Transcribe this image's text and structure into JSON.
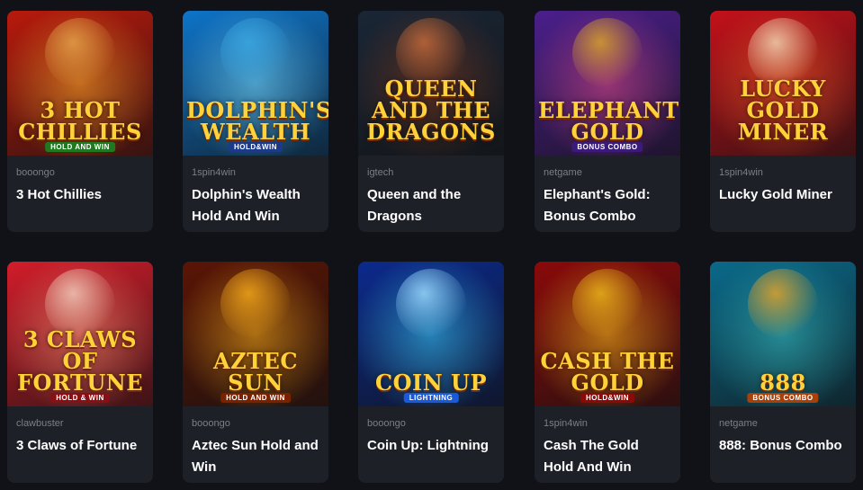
{
  "games": [
    {
      "provider": "booongo",
      "title": "3 Hot Chillies",
      "logo": "3 HOT CHILLIES",
      "sub": "HOLD AND WIN",
      "bg": "#b81a0c",
      "glow": "#ffb12b",
      "fig": "#e2a14a",
      "subbg": "#1f7a1f"
    },
    {
      "provider": "1spin4win",
      "title": "Dolphin's Wealth Hold And Win",
      "logo": "DOLPHIN'S WEALTH",
      "sub": "HOLD&WIN",
      "bg": "#0e74c9",
      "glow": "#7fe0ff",
      "fig": "#3aa6e0",
      "subbg": "#1b3a8a"
    },
    {
      "provider": "igtech",
      "title": "Queen and the Dragons",
      "logo": "QUEEN AND THE DRAGONS",
      "sub": "",
      "bg": "#1a2636",
      "glow": "#8a3a1a",
      "fig": "#c46a3a",
      "subbg": "#1a2636"
    },
    {
      "provider": "netgame",
      "title": "Elephant's Gold: Bonus Combo",
      "logo": "ELEPHANT'S GOLD",
      "sub": "BONUS COMBO",
      "bg": "#4b1f8c",
      "glow": "#e84a8a",
      "fig": "#d8a22a",
      "subbg": "#3a1a7a"
    },
    {
      "provider": "1spin4win",
      "title": "Lucky Gold Miner",
      "logo": "LUCKY GOLD MINER",
      "sub": "",
      "bg": "#c4111a",
      "glow": "#ff6a2a",
      "fig": "#f1d2b0",
      "subbg": "#c4111a"
    },
    {
      "provider": "clawbuster",
      "title": "3 Claws of Fortune",
      "logo": "3 CLAWS OF FORTUNE",
      "sub": "HOLD & WIN",
      "bg": "#d21d2a",
      "glow": "#ff9a7a",
      "fig": "#f0c8b8",
      "subbg": "#8a0f14"
    },
    {
      "provider": "booongo",
      "title": "Aztec Sun Hold and Win",
      "logo": "AZTEC SUN",
      "sub": "HOLD AND WIN",
      "bg": "#5a1505",
      "glow": "#ffb41a",
      "fig": "#f0a51a",
      "subbg": "#7a2200"
    },
    {
      "provider": "booongo",
      "title": "Coin Up: Lightning",
      "logo": "COIN UP",
      "sub": "LIGHTNING",
      "bg": "#0b2a8c",
      "glow": "#3ad0ff",
      "fig": "#9ad8ff",
      "subbg": "#1a5ad8"
    },
    {
      "provider": "1spin4win",
      "title": "Cash The Gold Hold And Win",
      "logo": "CASH THE GOLD",
      "sub": "HOLD&WIN",
      "bg": "#8a0a0a",
      "glow": "#ffc21a",
      "fig": "#e8b21a",
      "subbg": "#8a0a0a"
    },
    {
      "provider": "netgame",
      "title": "888: Bonus Combo",
      "logo": "888",
      "sub": "BONUS COMBO",
      "bg": "#0a6a8a",
      "glow": "#3ac0c0",
      "fig": "#e0a22a",
      "subbg": "#a8400a"
    }
  ]
}
